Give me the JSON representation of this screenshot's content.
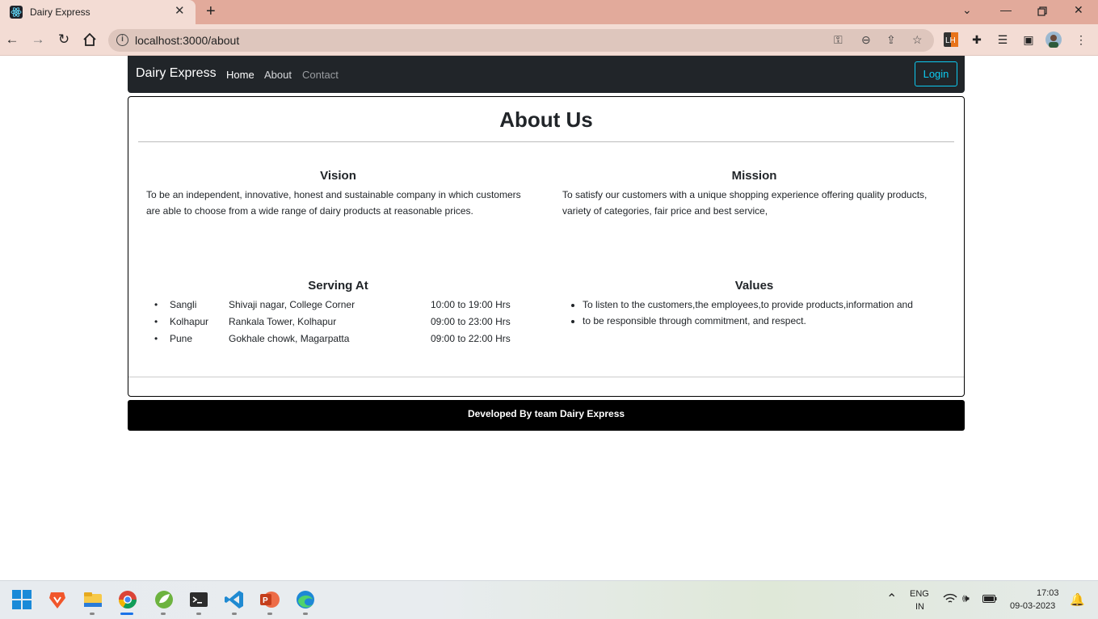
{
  "browser": {
    "tab_title": "Dairy Express",
    "url": "localhost:3000/about",
    "new_tab": "+"
  },
  "navbar": {
    "brand": "Dairy Express",
    "links": [
      {
        "label": "Home",
        "color": "#ffffff"
      },
      {
        "label": "About",
        "color": "#d7d9dc"
      },
      {
        "label": "Contact",
        "color": "#9a9da1"
      }
    ],
    "login": "Login"
  },
  "about": {
    "title": "About Us",
    "vision": {
      "heading": "Vision",
      "text": "To be an independent, innovative, honest and sustainable company in which customers are able to choose from a wide range of dairy products at reasonable prices."
    },
    "mission": {
      "heading": "Mission",
      "text": "To satisfy our customers with a unique shopping experience offering quality products, variety of categories, fair price and best service,"
    },
    "serving": {
      "heading": "Serving At",
      "locations": [
        {
          "city": "Sangli",
          "address": "Shivaji nagar, College Corner",
          "hours": "10:00 to 19:00 Hrs"
        },
        {
          "city": "Kolhapur",
          "address": "Rankala Tower, Kolhapur",
          "hours": "09:00 to 23:00 Hrs"
        },
        {
          "city": "Pune",
          "address": "Gokhale chowk, Magarpatta",
          "hours": "09:00 to 22:00 Hrs"
        }
      ]
    },
    "values": {
      "heading": "Values",
      "items": [
        "To listen to the customers,the employees,to provide products,information and",
        "to be responsible through commitment, and respect."
      ]
    }
  },
  "footer": {
    "text": "Developed By team Dairy Express"
  },
  "taskbar": {
    "lang_top": "ENG",
    "lang_bottom": "IN",
    "time": "17:03",
    "date": "09-03-2023"
  },
  "colors": {
    "navbar": "#212529",
    "login": "#0dcaf0",
    "titlebar": "#e2aa9b",
    "toolbar": "#f3dcd4"
  }
}
